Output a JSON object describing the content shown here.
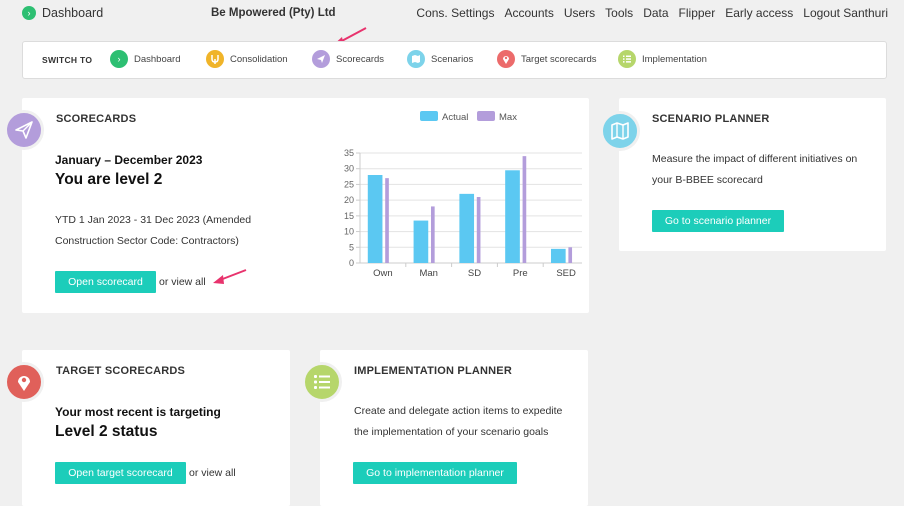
{
  "topnav": {
    "dashboard": "Dashboard",
    "company": "Be Mpowered (Pty) Ltd",
    "links": [
      "Cons. Settings",
      "Accounts",
      "Users",
      "Tools",
      "Data",
      "Flipper",
      "Early access",
      "Logout Santhuri"
    ]
  },
  "switchbar": {
    "label": "SWITCH TO",
    "items": [
      {
        "label": "Dashboard",
        "icon": "chevron-right-icon",
        "color": "#2dbf72"
      },
      {
        "label": "Consolidation",
        "icon": "consolidation-icon",
        "color": "#f0b429"
      },
      {
        "label": "Scorecards",
        "icon": "paper-plane-icon",
        "color": "#b39ddb"
      },
      {
        "label": "Scenarios",
        "icon": "map-icon",
        "color": "#7dd3ea"
      },
      {
        "label": "Target scorecards",
        "icon": "map-pin-icon",
        "color": "#ec6b6b"
      },
      {
        "label": "Implementation",
        "icon": "list-icon",
        "color": "#b6d66b"
      }
    ]
  },
  "scorecards": {
    "title": "SCORECARDS",
    "period": "January – December 2023",
    "level": "You are level 2",
    "ytd_line1": "YTD 1 Jan 2023 - 31 Dec 2023 (Amended",
    "ytd_line2": "Construction Sector Code: Contractors)",
    "button": "Open scorecard",
    "view_all": "or view all",
    "icon_color": "#b39ddb"
  },
  "chart_data": {
    "type": "bar",
    "categories": [
      "Own",
      "Man",
      "SD",
      "Pre",
      "SED"
    ],
    "series": [
      {
        "name": "Actual",
        "color": "#5bc8f2",
        "values": [
          28,
          13.5,
          22,
          29.5,
          4.5
        ]
      },
      {
        "name": "Max",
        "color": "#b39ddb",
        "values": [
          27,
          18,
          21,
          34,
          5
        ]
      }
    ],
    "ylim": [
      0,
      35
    ],
    "yticks": [
      0,
      5,
      10,
      15,
      20,
      25,
      30,
      35
    ],
    "grid": true,
    "legend": "top-center"
  },
  "scenario": {
    "title": "SCENARIO PLANNER",
    "text1": "Measure the impact of different initiatives on",
    "text2": "your B-BBEE scorecard",
    "button": "Go to scenario planner",
    "icon_color": "#7dd3ea"
  },
  "target": {
    "title": "TARGET SCORECARDS",
    "line1": "Your most recent is targeting",
    "line2": "Level 2 status",
    "button": "Open target scorecard",
    "view_all": "or view all",
    "icon_color": "#e0605a"
  },
  "implementation": {
    "title": "IMPLEMENTATION PLANNER",
    "text1": "Create and delegate action items to expedite",
    "text2": "the implementation of your scenario goals",
    "button": "Go to implementation planner",
    "icon_color": "#b6d66b"
  }
}
